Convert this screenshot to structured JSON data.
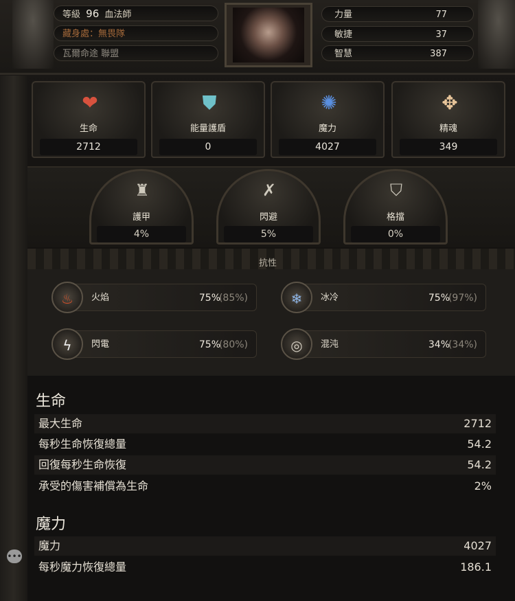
{
  "header": {
    "level_label": "等級",
    "level_value": "96",
    "class_name": "血法師",
    "hideout": "藏身處：無畏隊",
    "guild": "瓦爾命途 聯盟",
    "attributes": [
      {
        "label": "力量",
        "value": "77"
      },
      {
        "label": "敏捷",
        "value": "37"
      },
      {
        "label": "智慧",
        "value": "387"
      }
    ]
  },
  "core_stats": [
    {
      "label": "生命",
      "value": "2712",
      "icon": "heart-icon"
    },
    {
      "label": "能量護盾",
      "value": "0",
      "icon": "shield-crest-icon"
    },
    {
      "label": "魔力",
      "value": "4027",
      "icon": "mana-flask-icon"
    },
    {
      "label": "精魂",
      "value": "349",
      "icon": "spirit-orb-icon"
    }
  ],
  "defenses": [
    {
      "label": "護甲",
      "value": "4%",
      "icon": "armour-icon"
    },
    {
      "label": "閃避",
      "value": "5%",
      "icon": "evasion-icon"
    },
    {
      "label": "格擋",
      "value": "0%",
      "icon": "block-shield-icon"
    }
  ],
  "resistances": {
    "title": "抗性",
    "items": [
      {
        "label": "火焰",
        "value": "75%",
        "max": "(85%)",
        "icon": "fire-icon"
      },
      {
        "label": "冰冷",
        "value": "75%",
        "max": "(97%)",
        "icon": "cold-icon"
      },
      {
        "label": "閃電",
        "value": "75%",
        "max": "(80%)",
        "icon": "lightning-icon"
      },
      {
        "label": "混沌",
        "value": "34%",
        "max": "(34%)",
        "icon": "chaos-icon"
      }
    ]
  },
  "life_section": {
    "title": "生命",
    "rows": [
      {
        "label": "最大生命",
        "value": "2712"
      },
      {
        "label": "每秒生命恢復總量",
        "value": "54.2"
      },
      {
        "label": "回復每秒生命恢復",
        "value": "54.2"
      },
      {
        "label": "承受的傷害補償為生命",
        "value": "2%"
      }
    ]
  },
  "mana_section": {
    "title": "魔力",
    "rows": [
      {
        "label": "魔力",
        "value": "4027"
      },
      {
        "label": "每秒魔力恢復總量",
        "value": "186.1"
      }
    ]
  },
  "colors": {
    "accent_fire": "#d9502a",
    "accent_cold": "#6b9ad6",
    "accent_lightning": "#e8e8e8"
  }
}
